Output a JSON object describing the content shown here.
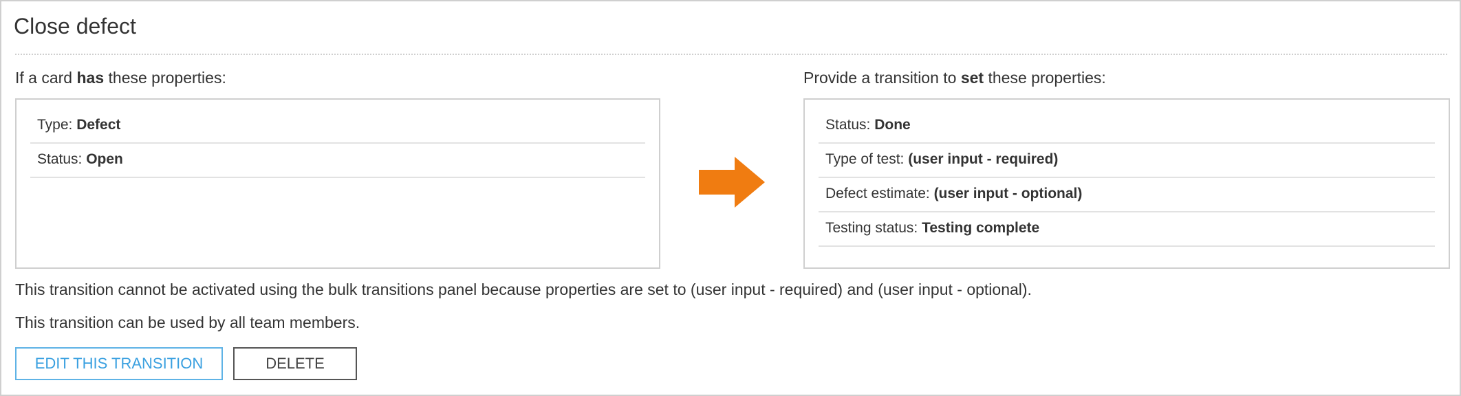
{
  "title": "Close defect",
  "left": {
    "heading_pre": "If a card ",
    "heading_bold": "has",
    "heading_post": " these properties:",
    "properties": [
      {
        "label": "Type: ",
        "value": "Defect"
      },
      {
        "label": "Status: ",
        "value": "Open"
      }
    ]
  },
  "right": {
    "heading_pre": "Provide a transition to ",
    "heading_bold": "set",
    "heading_post": " these properties:",
    "properties": [
      {
        "label": "Status: ",
        "value": "Done"
      },
      {
        "label": "Type of test: ",
        "value": "(user input - required)"
      },
      {
        "label": "Defect estimate: ",
        "value": "(user input - optional)"
      },
      {
        "label": "Testing status: ",
        "value": "Testing complete"
      }
    ]
  },
  "arrow": {
    "icon": "right-arrow-icon",
    "color": "#f07c11"
  },
  "info": {
    "bulk_notice": "This transition cannot be activated using the bulk transitions panel because properties are set to (user input - required) and (user input - optional).",
    "usage_notice": "This transition can be used by all team members."
  },
  "buttons": {
    "edit_label": "EDIT THIS TRANSITION",
    "delete_label": "DELETE"
  },
  "colors": {
    "accent": "#3aa0e0",
    "arrow": "#f07c11",
    "border": "#cfcfcf"
  }
}
